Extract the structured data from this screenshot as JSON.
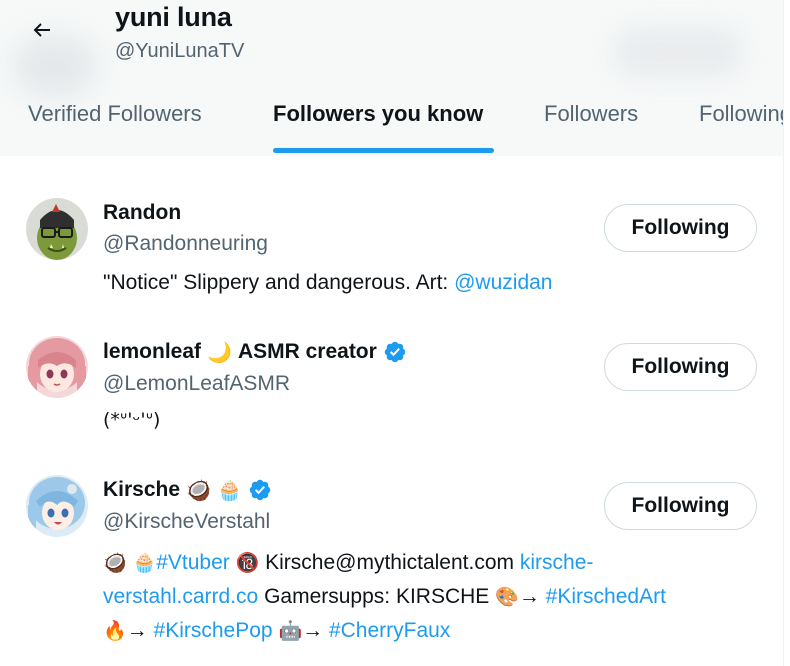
{
  "header": {
    "title": "yuni luna",
    "handle": "@YuniLunaTV"
  },
  "tabs": [
    "Verified Followers",
    "Followers you know",
    "Followers",
    "Following"
  ],
  "active_tab": "Followers you know",
  "users": [
    {
      "name": "Randon",
      "handle": "@Randonneuring",
      "button": "Following",
      "bio_text": "\"Notice\" Slippery and dangerous. Art: ",
      "bio_link": "@wuzidan"
    },
    {
      "name": "lemonleaf",
      "name_suffix": "ASMR creator",
      "handle": "@LemonLeafASMR",
      "button": "Following",
      "bio": "(*ᐡ'ᵕ'ᐡ)"
    },
    {
      "name": "Kirsche",
      "handle": "@KirscheVerstahl",
      "button": "Following",
      "bio": {
        "hashtag1": "#Vtuber",
        "email": "Kirsche@mythictalent.com",
        "link1a": "kirsche-",
        "link1b": "verstahl.carrd.co",
        "text2": "Gamersupps: KIRSCHE",
        "hashtag2": "#KirschedArt",
        "hashtag3": "#KirschePop",
        "hashtag4": "#CherryFaux"
      }
    }
  ],
  "colors": {
    "accent": "#1d9bf0",
    "secondary_text": "#536471",
    "verified": "#1d9bf0"
  },
  "icons": [
    "back-arrow-icon",
    "verified-badge-icon",
    "moon-emoji",
    "coconut-emoji",
    "cupcake-emoji",
    "no-under-18-emoji",
    "palette-emoji",
    "fire-emoji",
    "robot-emoji"
  ]
}
